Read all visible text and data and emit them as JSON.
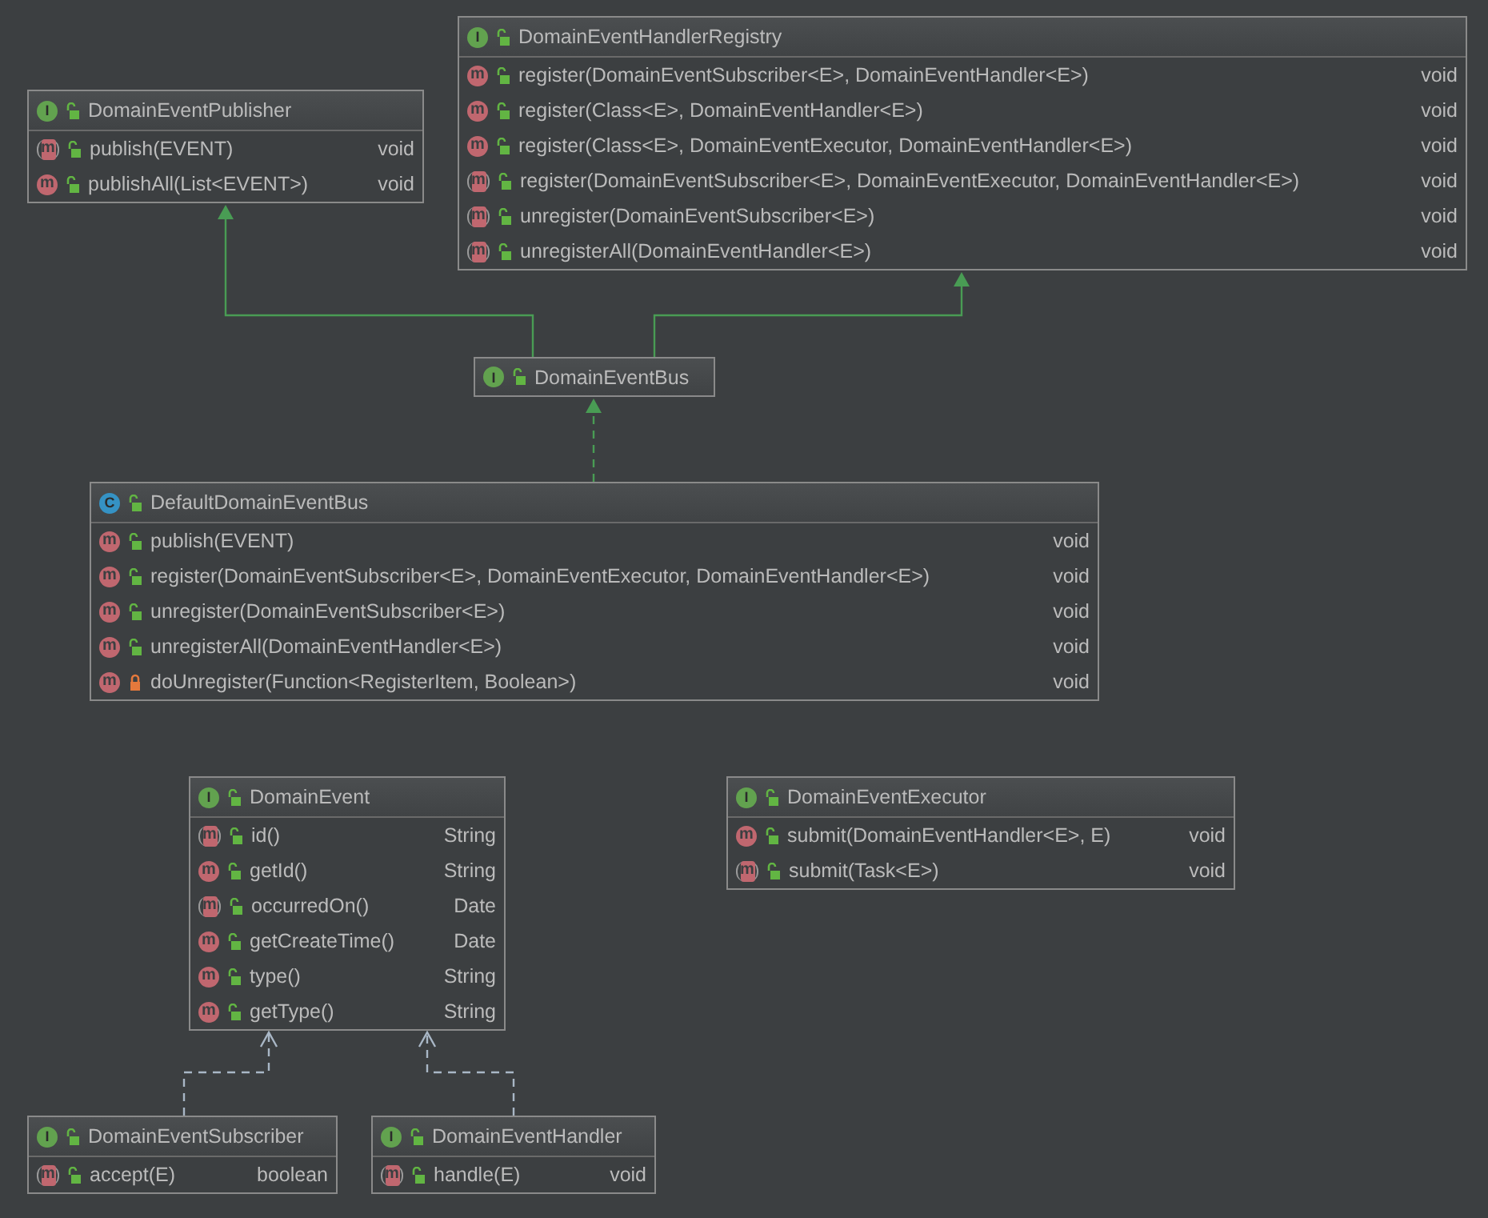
{
  "diagram": {
    "nodes": [
      {
        "kind": "interface",
        "badge": "I",
        "name": "DomainEventPublisher",
        "methods": [
          {
            "badge": "m",
            "abstract": true,
            "private": false,
            "signature": "publish(EVENT)",
            "returns": "void"
          },
          {
            "badge": "m",
            "abstract": false,
            "private": false,
            "signature": "publishAll(List<EVENT>)",
            "returns": "void"
          }
        ]
      },
      {
        "kind": "interface",
        "badge": "I",
        "name": "DomainEventHandlerRegistry",
        "methods": [
          {
            "badge": "m",
            "abstract": false,
            "private": false,
            "signature": "register(DomainEventSubscriber<E>, DomainEventHandler<E>)",
            "returns": "void"
          },
          {
            "badge": "m",
            "abstract": false,
            "private": false,
            "signature": "register(Class<E>, DomainEventHandler<E>)",
            "returns": "void"
          },
          {
            "badge": "m",
            "abstract": false,
            "private": false,
            "signature": "register(Class<E>, DomainEventExecutor, DomainEventHandler<E>)",
            "returns": "void"
          },
          {
            "badge": "m",
            "abstract": true,
            "private": false,
            "signature": "register(DomainEventSubscriber<E>, DomainEventExecutor, DomainEventHandler<E>)",
            "returns": "void"
          },
          {
            "badge": "m",
            "abstract": true,
            "private": false,
            "signature": "unregister(DomainEventSubscriber<E>)",
            "returns": "void"
          },
          {
            "badge": "m",
            "abstract": true,
            "private": false,
            "signature": "unregisterAll(DomainEventHandler<E>)",
            "returns": "void"
          }
        ]
      },
      {
        "kind": "interface",
        "badge": "I",
        "name": "DomainEventBus"
      },
      {
        "kind": "class",
        "badge": "C",
        "name": "DefaultDomainEventBus",
        "methods": [
          {
            "badge": "m",
            "abstract": false,
            "private": false,
            "signature": "publish(EVENT)",
            "returns": "void"
          },
          {
            "badge": "m",
            "abstract": false,
            "private": false,
            "signature": "register(DomainEventSubscriber<E>, DomainEventExecutor, DomainEventHandler<E>)",
            "returns": "void"
          },
          {
            "badge": "m",
            "abstract": false,
            "private": false,
            "signature": "unregister(DomainEventSubscriber<E>)",
            "returns": "void"
          },
          {
            "badge": "m",
            "abstract": false,
            "private": false,
            "signature": "unregisterAll(DomainEventHandler<E>)",
            "returns": "void"
          },
          {
            "badge": "m",
            "abstract": false,
            "private": true,
            "signature": "doUnregister(Function<RegisterItem, Boolean>)",
            "returns": "void"
          }
        ]
      },
      {
        "kind": "interface",
        "badge": "I",
        "name": "DomainEvent",
        "methods": [
          {
            "badge": "m",
            "abstract": true,
            "private": false,
            "signature": "id()",
            "returns": "String"
          },
          {
            "badge": "m",
            "abstract": false,
            "private": false,
            "signature": "getId()",
            "returns": "String"
          },
          {
            "badge": "m",
            "abstract": true,
            "private": false,
            "signature": "occurredOn()",
            "returns": "Date"
          },
          {
            "badge": "m",
            "abstract": false,
            "private": false,
            "signature": "getCreateTime()",
            "returns": "Date"
          },
          {
            "badge": "m",
            "abstract": false,
            "private": false,
            "signature": "type()",
            "returns": "String"
          },
          {
            "badge": "m",
            "abstract": false,
            "private": false,
            "signature": "getType()",
            "returns": "String"
          }
        ]
      },
      {
        "kind": "interface",
        "badge": "I",
        "name": "DomainEventExecutor",
        "methods": [
          {
            "badge": "m",
            "abstract": false,
            "private": false,
            "signature": "submit(DomainEventHandler<E>, E)",
            "returns": "void"
          },
          {
            "badge": "m",
            "abstract": true,
            "private": false,
            "signature": "submit(Task<E>)",
            "returns": "void"
          }
        ]
      },
      {
        "kind": "interface",
        "badge": "I",
        "name": "DomainEventSubscriber",
        "methods": [
          {
            "badge": "m",
            "abstract": true,
            "private": false,
            "signature": "accept(E)",
            "returns": "boolean"
          }
        ]
      },
      {
        "kind": "interface",
        "badge": "I",
        "name": "DomainEventHandler",
        "methods": [
          {
            "badge": "m",
            "abstract": true,
            "private": false,
            "signature": "handle(E)",
            "returns": "void"
          }
        ]
      }
    ],
    "edges": [
      {
        "kind": "extends"
      },
      {
        "kind": "extends"
      },
      {
        "kind": "implements"
      },
      {
        "kind": "uses"
      },
      {
        "kind": "uses"
      }
    ]
  }
}
